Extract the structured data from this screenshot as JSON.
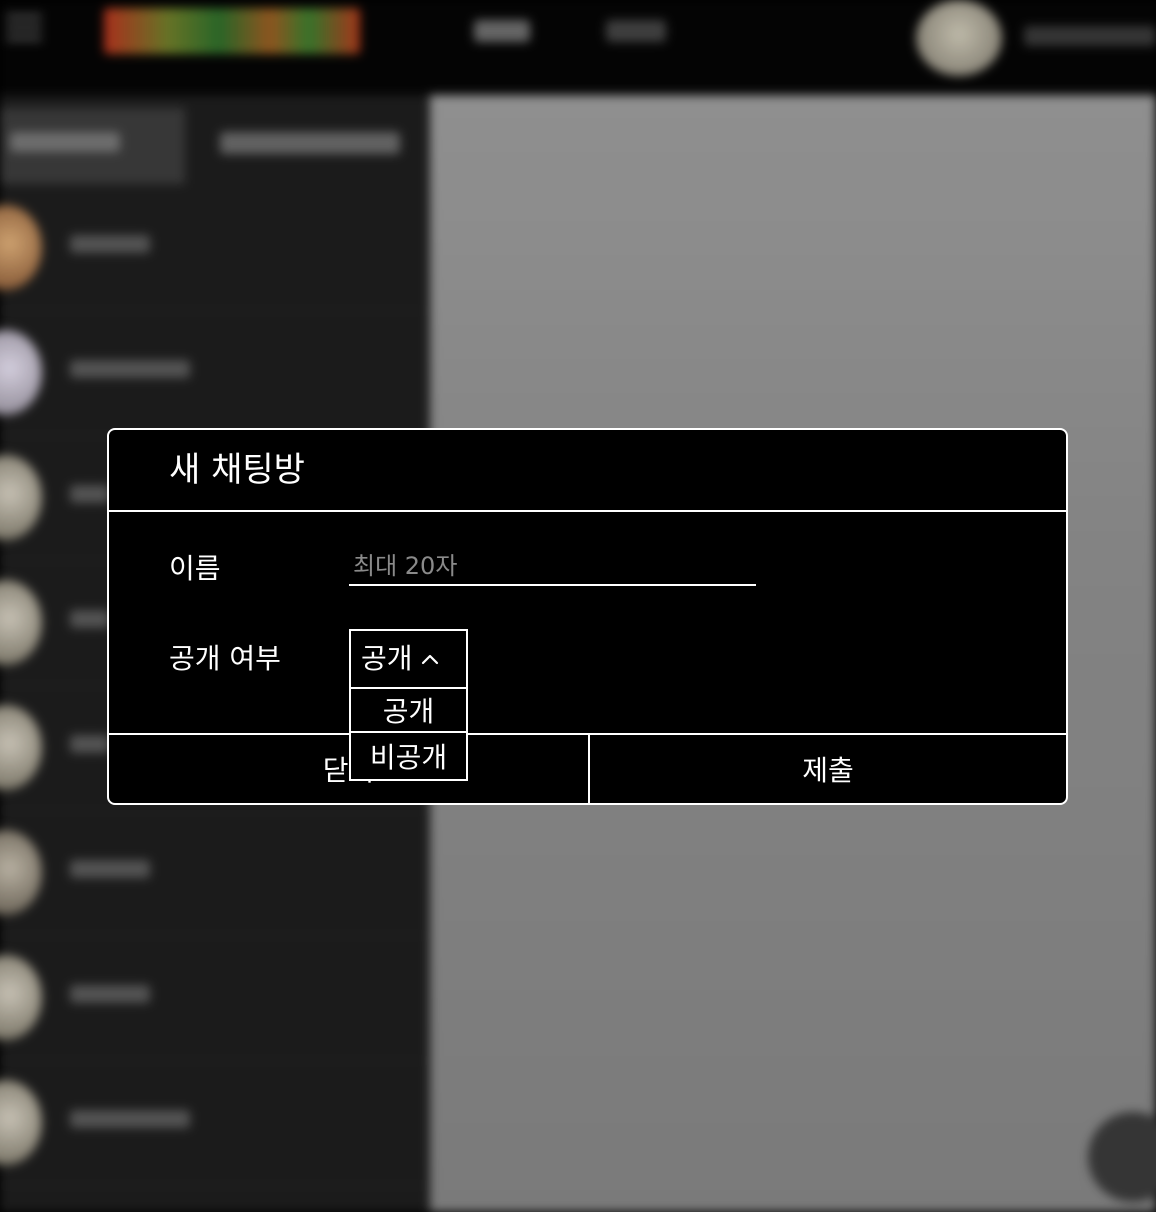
{
  "modal": {
    "title": "새 채팅방",
    "name_label": "이름",
    "name_placeholder": "최대 20자",
    "name_value": "",
    "visibility_label": "공개 여부",
    "visibility_selected": "공개",
    "visibility_options": [
      "공개",
      "비공개"
    ],
    "close_label": "닫기",
    "submit_label": "제출"
  },
  "icons": {
    "dropdown_toggle": "chevron-up-icon",
    "menu": "hamburger-icon",
    "fab": "plus-icon"
  },
  "colors": {
    "modal_bg": "#000000",
    "modal_border": "#ffffff",
    "placeholder": "#8a8a8a",
    "overlay": "#808080"
  }
}
